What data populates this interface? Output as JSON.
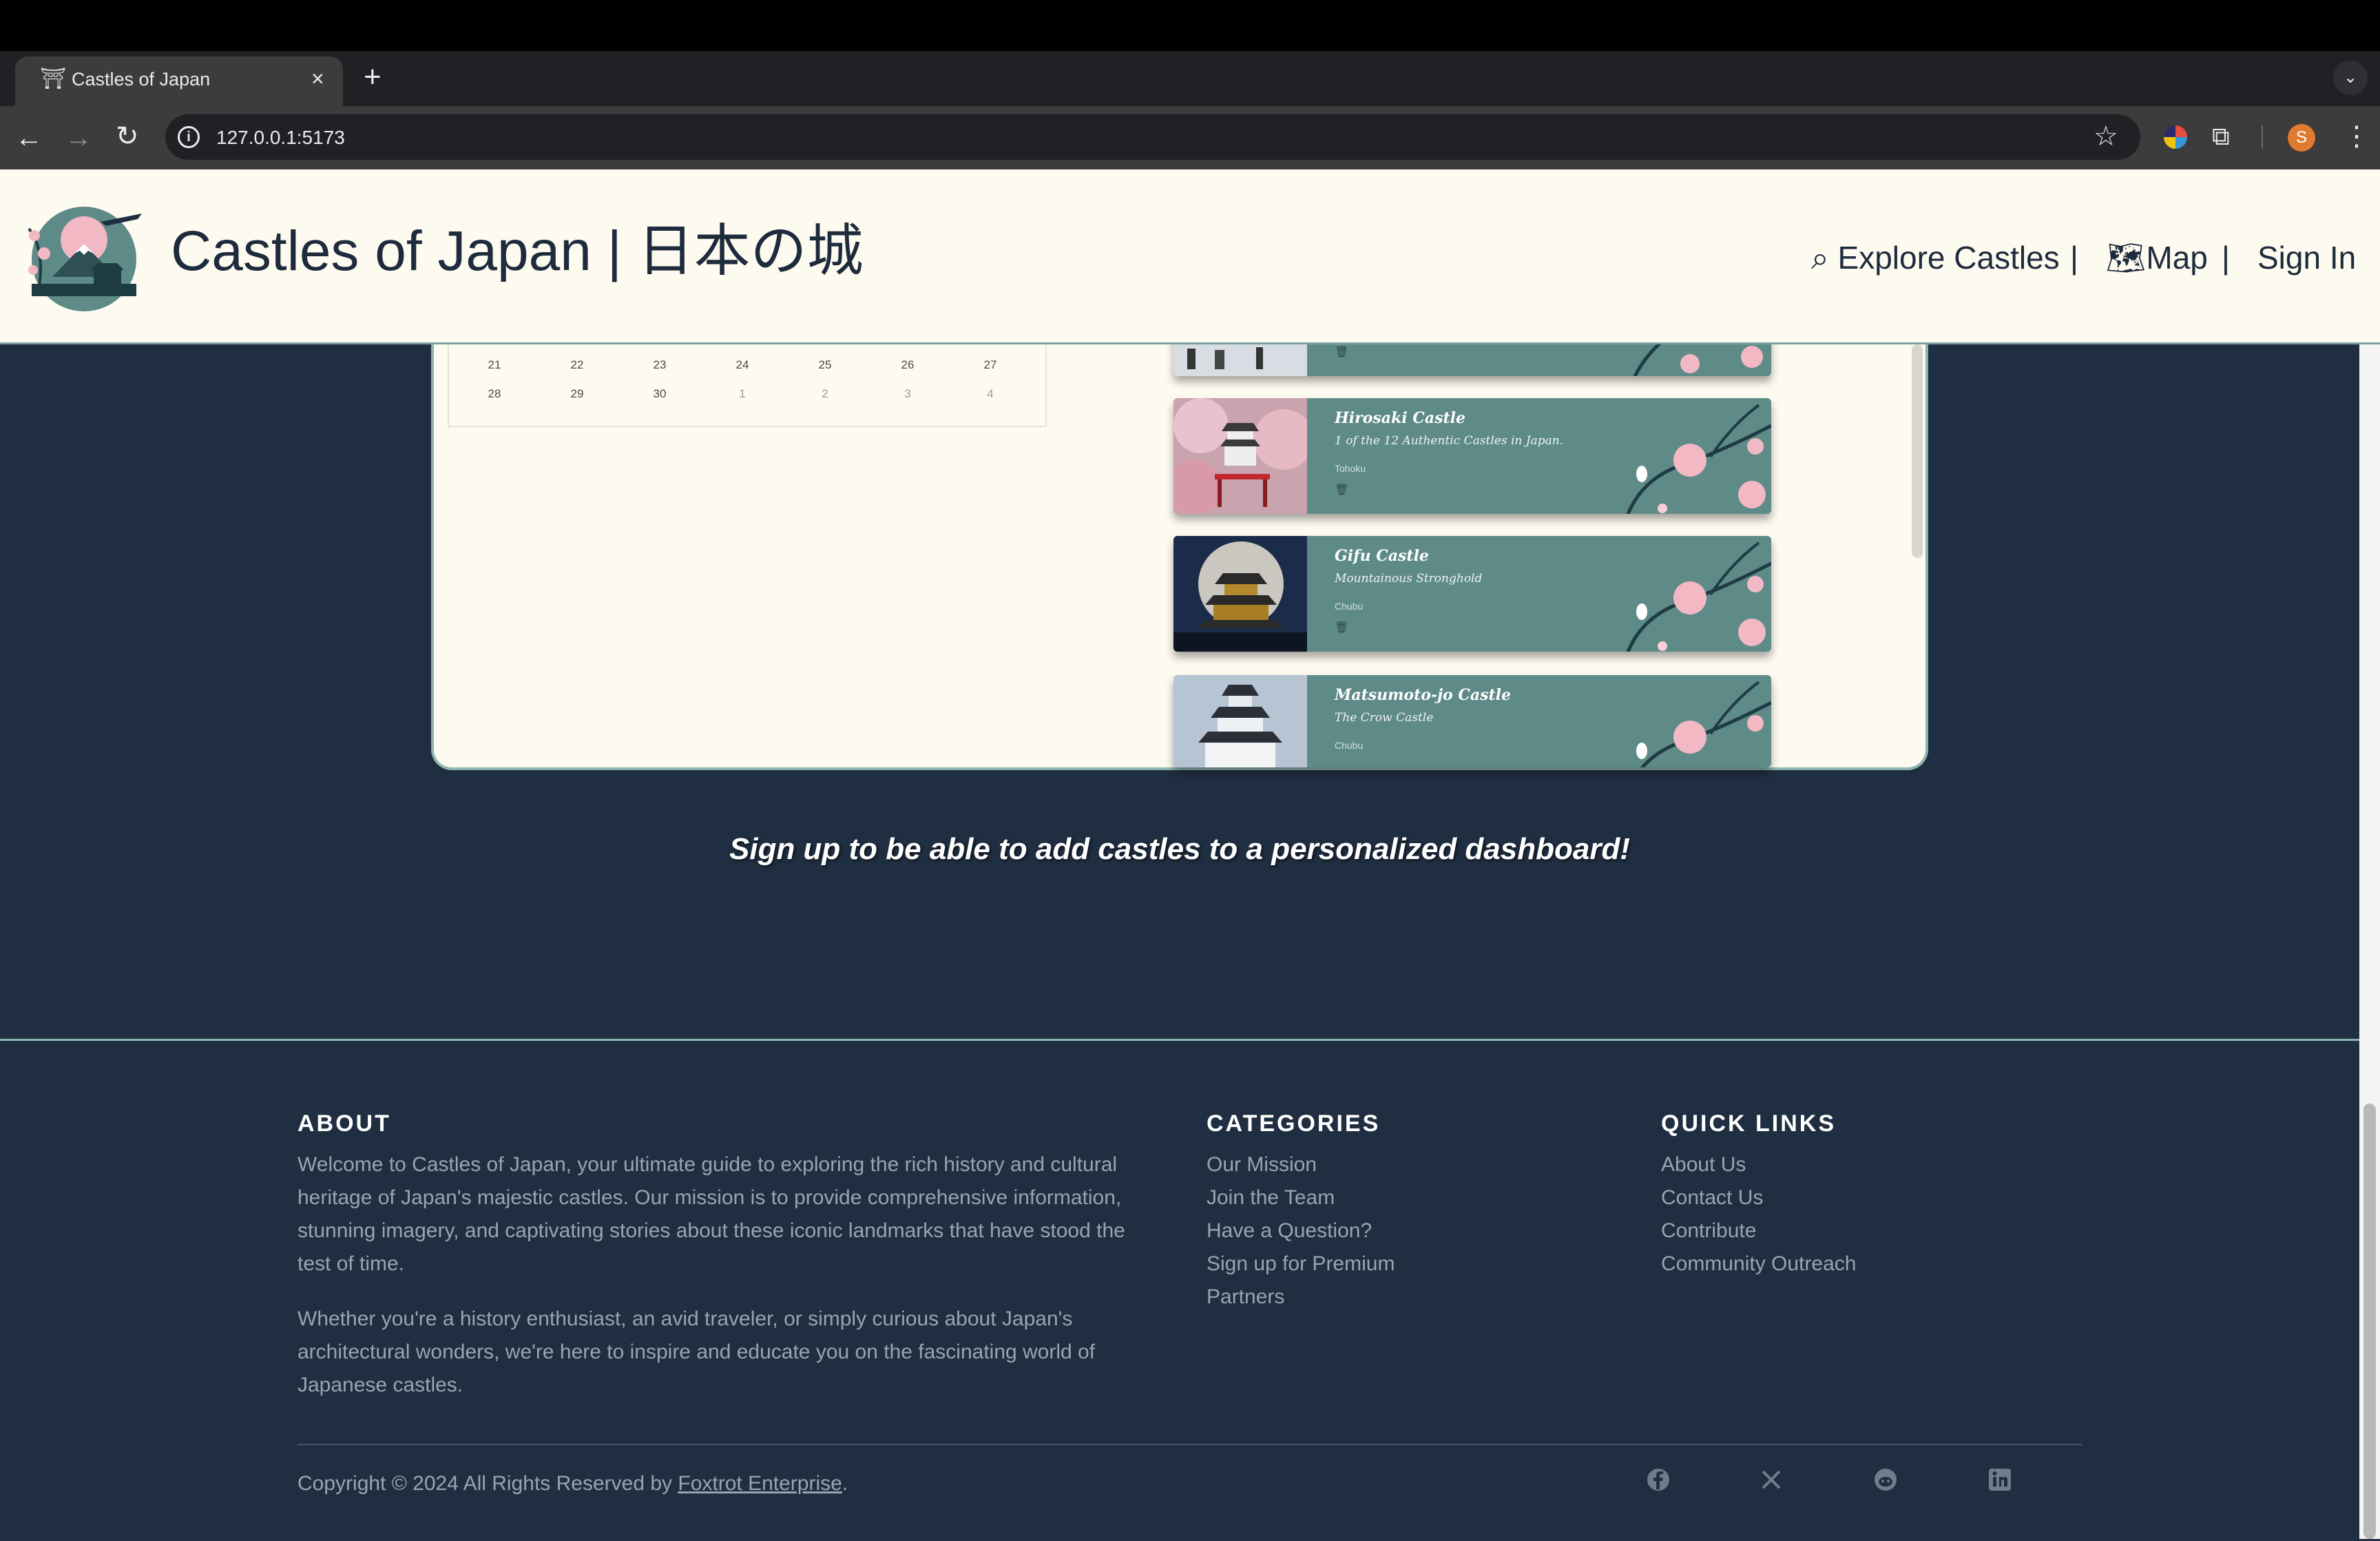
{
  "browser": {
    "tab_title": "Castles of Japan",
    "url": "127.0.0.1:5173",
    "profile_initial": "S"
  },
  "header": {
    "title": "Castles of Japan | 日本の城",
    "nav": {
      "explore": "Explore Castles",
      "separator": "|",
      "map": "Map",
      "signin": "Sign In"
    }
  },
  "calendar": {
    "rows": [
      [
        "21",
        "22",
        "23",
        "24",
        "25",
        "26",
        "27"
      ],
      [
        "28",
        "29",
        "30",
        "1",
        "2",
        "3",
        "4"
      ]
    ]
  },
  "cards": [
    {
      "name": "",
      "subtitle": "",
      "region": "",
      "partial": true
    },
    {
      "name": "Hirosaki Castle",
      "subtitle": "1 of the 12 Authentic Castles in Japan.",
      "region": "Tohoku"
    },
    {
      "name": "Gifu Castle",
      "subtitle": "Mountainous Stronghold",
      "region": "Chubu"
    },
    {
      "name": "Matsumoto-jo Castle",
      "subtitle": "The Crow Castle",
      "region": "Chubu"
    }
  ],
  "signup_message": "Sign up to be able to add castles to a personalized dashboard!",
  "footer": {
    "about": {
      "heading": "ABOUT",
      "p1_lines": [
        "Welcome to Castles of Japan, your ultimate guide to exploring the rich history and cultural",
        "heritage of Japan's majestic castles. Our mission is to provide comprehensive information,",
        "stunning imagery, and captivating stories about these iconic landmarks that have stood the",
        "test of time."
      ],
      "p2_lines": [
        "Whether you're a history enthusiast, an avid traveler, or simply curious about Japan's",
        "architectural wonders, we're here to inspire and educate you on the fascinating world of",
        "Japanese castles."
      ]
    },
    "categories": {
      "heading": "CATEGORIES",
      "links": [
        "Our Mission",
        "Join the Team",
        "Have a Question?",
        "Sign up for Premium",
        "Partners"
      ]
    },
    "quick_links": {
      "heading": "QUICK LINKS",
      "links": [
        "About Us",
        "Contact Us",
        "Contribute",
        "Community Outreach"
      ]
    },
    "copyright_prefix": "Copyright © 2024 All Rights Reserved by ",
    "copyright_link": "Foxtrot Enterprise",
    "copyright_suffix": ".",
    "social_icons": [
      "facebook-icon",
      "x-icon",
      "reddit-icon",
      "linkedin-icon"
    ]
  },
  "colors": {
    "page_bg": "#1f2e41",
    "header_bg": "#fdfaf0",
    "card_bg": "#5e8b88",
    "accent_border": "#8db5b0"
  }
}
